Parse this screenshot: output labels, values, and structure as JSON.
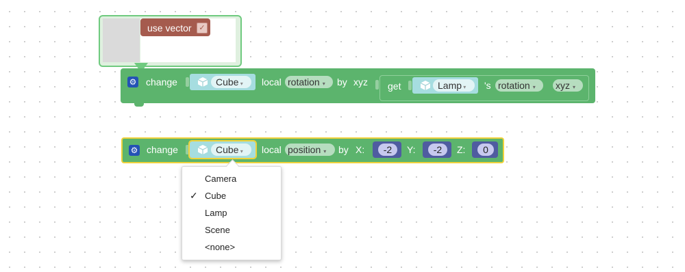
{
  "bubble": {
    "use_vector_label": "use vector",
    "checkbox_mark": "✓"
  },
  "block1": {
    "verb": "change",
    "object": "Cube",
    "local": "local",
    "property": "rotation",
    "by": "by",
    "mode": "xyz",
    "getter": {
      "get": "get",
      "object": "Lamp",
      "possessive": "'s",
      "property": "rotation",
      "component": "xyz"
    }
  },
  "block2": {
    "verb": "change",
    "object": "Cube",
    "local": "local",
    "property": "position",
    "by": "by",
    "x_label": "X:",
    "x_value": "-2",
    "y_label": "Y:",
    "y_value": "-2",
    "z_label": "Z:",
    "z_value": "0"
  },
  "dropdown": {
    "options": [
      "Camera",
      "Cube",
      "Lamp",
      "Scene",
      "<none>"
    ],
    "selected": "Cube",
    "check_mark": "✓"
  },
  "colors": {
    "block_green": "#5cb46d",
    "selection_yellow": "#f0d23a",
    "object_teal": "#a6dde0",
    "number_purple": "#4f5ca0",
    "logic_red": "#a55b4e",
    "gear_blue": "#2452b5"
  }
}
